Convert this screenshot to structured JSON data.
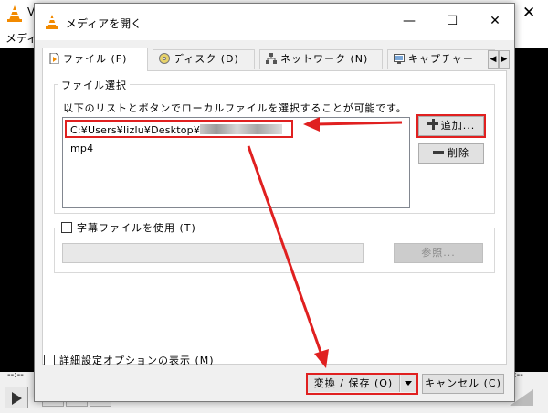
{
  "background_app": {
    "title": "V",
    "menu_text": "メディ",
    "close_glyph": "✕",
    "seek_left": "--:--",
    "seek_right": "--:--"
  },
  "dialog": {
    "title": "メディアを開く",
    "minimize_glyph": "—",
    "maximize_glyph": "☐",
    "close_glyph": "✕"
  },
  "tabs": [
    {
      "label": "ファイル (F)",
      "icon": "file-icon"
    },
    {
      "label": "ディスク (D)",
      "icon": "disc-icon"
    },
    {
      "label": "ネットワーク (N)",
      "icon": "network-icon"
    },
    {
      "label": "キャプチャー",
      "icon": "capture-icon"
    }
  ],
  "tab_scroll": {
    "left": "◀",
    "right": "▶"
  },
  "file_selection": {
    "legend": "ファイル選択",
    "info": "以下のリストとボタンでローカルファイルを選択することが可能です。",
    "file_path_prefix": "C:¥Users¥lizlu¥Desktop¥",
    "file_path_suffix": "mp4",
    "add_button": "追加...",
    "remove_button": "削除"
  },
  "subtitle": {
    "checkbox_label": "字幕ファイルを使用 (T)",
    "input_value": "",
    "browse_button": "参照..."
  },
  "footer": {
    "advanced_options_label": "詳細設定オプションの表示 (M)",
    "convert_button": "変換 / 保存 (O)",
    "cancel_button": "キャンセル (C)"
  },
  "colors": {
    "annotation_red": "#e02020",
    "dialog_bg": "#f0f0f0",
    "panel_bg": "#ffffff"
  }
}
